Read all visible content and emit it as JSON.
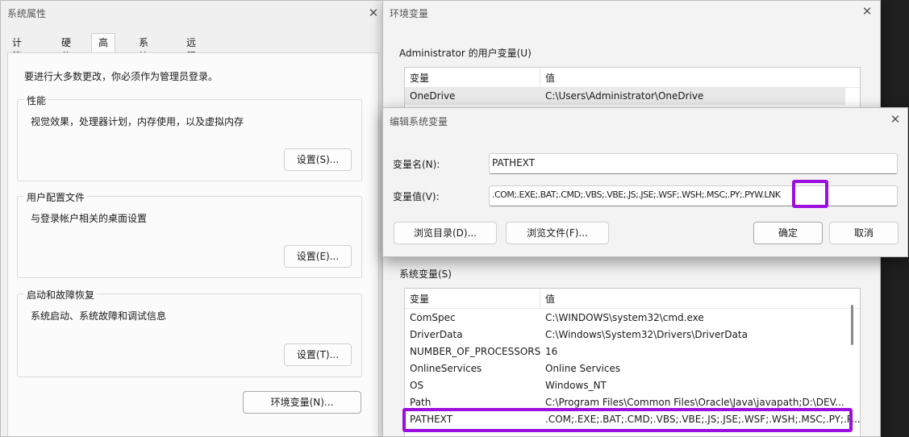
{
  "system_props": {
    "title": "系统属性",
    "tabs": [
      "计算机名",
      "硬件",
      "高级",
      "系统保护",
      "远程"
    ],
    "intro": "要进行大多数更改，你必须作为管理员登录。",
    "performance": {
      "label": "性能",
      "desc": "视觉效果，处理器计划，内存使用，以及虚拟内存",
      "button": "设置(S)..."
    },
    "user_profiles": {
      "label": "用户配置文件",
      "desc": "与登录帐户相关的桌面设置",
      "button": "设置(E)..."
    },
    "startup": {
      "label": "启动和故障恢复",
      "desc": "系统启动、系统故障和调试信息",
      "button": "设置(T)..."
    },
    "env_button": "环境变量(N)..."
  },
  "env_vars": {
    "title": "环境变量",
    "user_label": "Administrator 的用户变量(U)",
    "columns": [
      "变量",
      "值"
    ],
    "user_rows": [
      {
        "name": "OneDrive",
        "value": "C:\\Users\\Administrator\\OneDrive"
      }
    ],
    "system_label": "系统变量(S)",
    "system_rows": [
      {
        "name": "ComSpec",
        "value": "C:\\WINDOWS\\system32\\cmd.exe"
      },
      {
        "name": "DriverData",
        "value": "C:\\Windows\\System32\\Drivers\\DriverData"
      },
      {
        "name": "NUMBER_OF_PROCESSORS",
        "value": "16"
      },
      {
        "name": "OnlineServices",
        "value": "Online Services"
      },
      {
        "name": "OS",
        "value": "Windows_NT"
      },
      {
        "name": "Path",
        "value": "C:\\Program Files\\Common Files\\Oracle\\Java\\javapath;D:\\DEV..."
      },
      {
        "name": "PATHEXT",
        "value": ".COM;.EXE;.BAT;.CMD;.VBS;.VBE;.JS;.JSE;.WSF;.WSH;.MSC;.PY;.P..."
      }
    ]
  },
  "edit_var": {
    "title": "编辑系统变量",
    "name_label": "变量名(N):",
    "name_value": "PATHEXT",
    "value_label": "变量值(V):",
    "value_prefix": ".COM;.EXE;.BAT;.CMD;.VBS;.VBE;.JS;.JSE;.WSF;.WSH;.MSC;.PY;.PYW",
    "value_suffix": ".LNK",
    "browse_dir": "浏览目录(D)...",
    "browse_file": "浏览文件(F)...",
    "ok": "确定",
    "cancel": "取消"
  },
  "colors": {
    "highlight": "#9b0ee0",
    "window_bg": "#f3f3f3"
  },
  "icons": {
    "close": "close-icon"
  }
}
